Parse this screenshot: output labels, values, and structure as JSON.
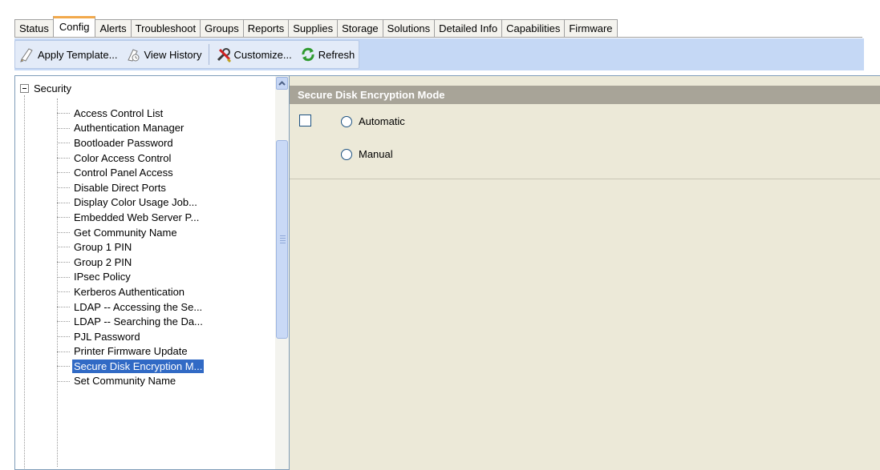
{
  "tabs": [
    {
      "label": "Status",
      "active": false
    },
    {
      "label": "Config",
      "active": true
    },
    {
      "label": "Alerts",
      "active": false
    },
    {
      "label": "Troubleshoot",
      "active": false
    },
    {
      "label": "Groups",
      "active": false
    },
    {
      "label": "Reports",
      "active": false
    },
    {
      "label": "Supplies",
      "active": false
    },
    {
      "label": "Storage",
      "active": false
    },
    {
      "label": "Solutions",
      "active": false
    },
    {
      "label": "Detailed Info",
      "active": false
    },
    {
      "label": "Capabilities",
      "active": false
    },
    {
      "label": "Firmware",
      "active": false
    }
  ],
  "toolbar": {
    "apply_template": {
      "label": "Apply Template...",
      "icon": "template-icon"
    },
    "view_history": {
      "label": "View History",
      "icon": "history-icon"
    },
    "customize": {
      "label": "Customize...",
      "icon": "tools-icon"
    },
    "refresh": {
      "label": "Refresh",
      "icon": "refresh-icon"
    }
  },
  "tree": {
    "root_label": "Security",
    "selected": "Secure Disk Encryption M...",
    "items": [
      "Access Control List",
      "Authentication Manager",
      "Bootloader Password",
      "Color Access Control",
      "Control Panel Access",
      "Disable Direct Ports",
      "Display Color Usage Job...",
      "Embedded Web Server P...",
      "Get Community Name",
      "Group 1 PIN",
      "Group 2 PIN",
      "IPsec Policy",
      "Kerberos Authentication",
      "LDAP -- Accessing the Se...",
      "LDAP -- Searching the Da...",
      "PJL Password",
      "Printer Firmware Update",
      "Secure Disk Encryption M...",
      "Set Community Name"
    ]
  },
  "panel": {
    "title": "Secure Disk Encryption Mode",
    "options": {
      "automatic": "Automatic",
      "manual": "Manual"
    }
  },
  "colors": {
    "accent_tab": "#f2a94b",
    "toolbar_bg": "#c5d8f5",
    "selection": "#316ac5",
    "panel_header": "#a8a498",
    "panel_bg": "#ece9d8"
  }
}
